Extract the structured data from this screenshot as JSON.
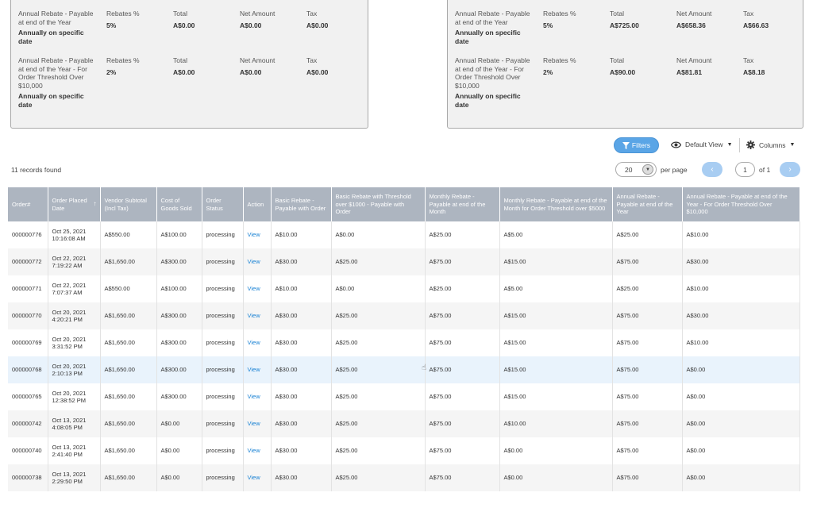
{
  "summary_cards": [
    {
      "rebates": [
        {
          "description": "Annual Rebate - Payable at end of the Year",
          "frequency": "Annually on specific date",
          "rebates_label": "Rebates %",
          "rebates_value": "5%",
          "total_label": "Total",
          "total_value": "A$0.00",
          "net_label": "Net Amount",
          "net_value": "A$0.00",
          "tax_label": "Tax",
          "tax_value": "A$0.00"
        },
        {
          "description": "Annual Rebate - Payable at end of the Year - For Order Threshold Over $10,000",
          "frequency": "Annually on specific date",
          "rebates_label": "Rebates %",
          "rebates_value": "2%",
          "total_label": "Total",
          "total_value": "A$0.00",
          "net_label": "Net Amount",
          "net_value": "A$0.00",
          "tax_label": "Tax",
          "tax_value": "A$0.00"
        }
      ]
    },
    {
      "rebates": [
        {
          "description": "Annual Rebate - Payable at end of the Year",
          "frequency": "Annually on specific date",
          "rebates_label": "Rebates %",
          "rebates_value": "5%",
          "total_label": "Total",
          "total_value": "A$725.00",
          "net_label": "Net Amount",
          "net_value": "A$658.36",
          "tax_label": "Tax",
          "tax_value": "A$66.63"
        },
        {
          "description": "Annual Rebate - Payable at end of the Year - For Order Threshold Over $10,000",
          "frequency": "Annually on specific date",
          "rebates_label": "Rebates %",
          "rebates_value": "2%",
          "total_label": "Total",
          "total_value": "A$90.00",
          "net_label": "Net Amount",
          "net_value": "A$81.81",
          "tax_label": "Tax",
          "tax_value": "A$8.18"
        }
      ]
    }
  ],
  "toolbar": {
    "filters_label": "Filters",
    "view_label": "Default View",
    "columns_label": "Columns",
    "icons": {
      "filters": "funnel-icon",
      "view": "eye-icon",
      "columns": "gear-icon"
    }
  },
  "records_found": "11 records found",
  "pagination": {
    "per_page_value": "20",
    "per_page_label": "per page",
    "current_page": "1",
    "of_label": "of 1",
    "prev": "‹",
    "next": "›"
  },
  "accent_color": "#5aa5e6",
  "table": {
    "columns": [
      "Order#",
      "Order Placed Date",
      "Vendor Subtotal (Incl Tax)",
      "Cost of Goods Sold",
      "Order Status",
      "Action",
      "Basic Rebate - Payable with Order",
      "Basic Rebate with Threshold over $1000 - Payable with Order",
      "Monthly Rebate - Payable at end of the Month",
      "Monthly Rebate - Payable at end of the Month for Order Threshold over $5000",
      "Annual Rebate - Payable at end of the Year",
      "Annual Rebate - Payable at end of the Year - For Order Threshold Over $10,000"
    ],
    "rows": [
      [
        "000000776",
        "Oct 25, 2021 10:16:08 AM",
        "A$550.00",
        "A$100.00",
        "processing",
        "View",
        "A$10.00",
        "A$0.00",
        "A$25.00",
        "A$5.00",
        "A$25.00",
        "A$10.00"
      ],
      [
        "000000772",
        "Oct 22, 2021 7:19:22 AM",
        "A$1,650.00",
        "A$300.00",
        "processing",
        "View",
        "A$30.00",
        "A$25.00",
        "A$75.00",
        "A$15.00",
        "A$75.00",
        "A$30.00"
      ],
      [
        "000000771",
        "Oct 22, 2021 7:07:37 AM",
        "A$550.00",
        "A$100.00",
        "processing",
        "View",
        "A$10.00",
        "A$0.00",
        "A$25.00",
        "A$5.00",
        "A$25.00",
        "A$10.00"
      ],
      [
        "000000770",
        "Oct 20, 2021 4:20:21 PM",
        "A$1,650.00",
        "A$300.00",
        "processing",
        "View",
        "A$30.00",
        "A$25.00",
        "A$75.00",
        "A$15.00",
        "A$75.00",
        "A$30.00"
      ],
      [
        "000000769",
        "Oct 20, 2021 3:31:52 PM",
        "A$1,650.00",
        "A$300.00",
        "processing",
        "View",
        "A$30.00",
        "A$25.00",
        "A$75.00",
        "A$15.00",
        "A$75.00",
        "A$10.00"
      ],
      [
        "000000768",
        "Oct 20, 2021 2:10:13 PM",
        "A$1,650.00",
        "A$300.00",
        "processing",
        "View",
        "A$30.00",
        "A$25.00",
        "A$75.00",
        "A$15.00",
        "A$75.00",
        "A$0.00"
      ],
      [
        "000000765",
        "Oct 20, 2021 12:38:52 PM",
        "A$1,650.00",
        "A$300.00",
        "processing",
        "View",
        "A$30.00",
        "A$25.00",
        "A$75.00",
        "A$15.00",
        "A$75.00",
        "A$0.00"
      ],
      [
        "000000742",
        "Oct 13, 2021 4:08:05 PM",
        "A$1,650.00",
        "A$0.00",
        "processing",
        "View",
        "A$30.00",
        "A$25.00",
        "A$75.00",
        "A$10.00",
        "A$75.00",
        "A$0.00"
      ],
      [
        "000000740",
        "Oct 13, 2021 2:41:40 PM",
        "A$1,650.00",
        "A$0.00",
        "processing",
        "View",
        "A$30.00",
        "A$25.00",
        "A$75.00",
        "A$0.00",
        "A$75.00",
        "A$0.00"
      ],
      [
        "000000738",
        "Oct 13, 2021 2:29:50 PM",
        "A$1,650.00",
        "A$0.00",
        "processing",
        "View",
        "A$30.00",
        "A$25.00",
        "A$75.00",
        "A$0.00",
        "A$75.00",
        "A$0.00"
      ]
    ],
    "highlighted_row": 5
  }
}
